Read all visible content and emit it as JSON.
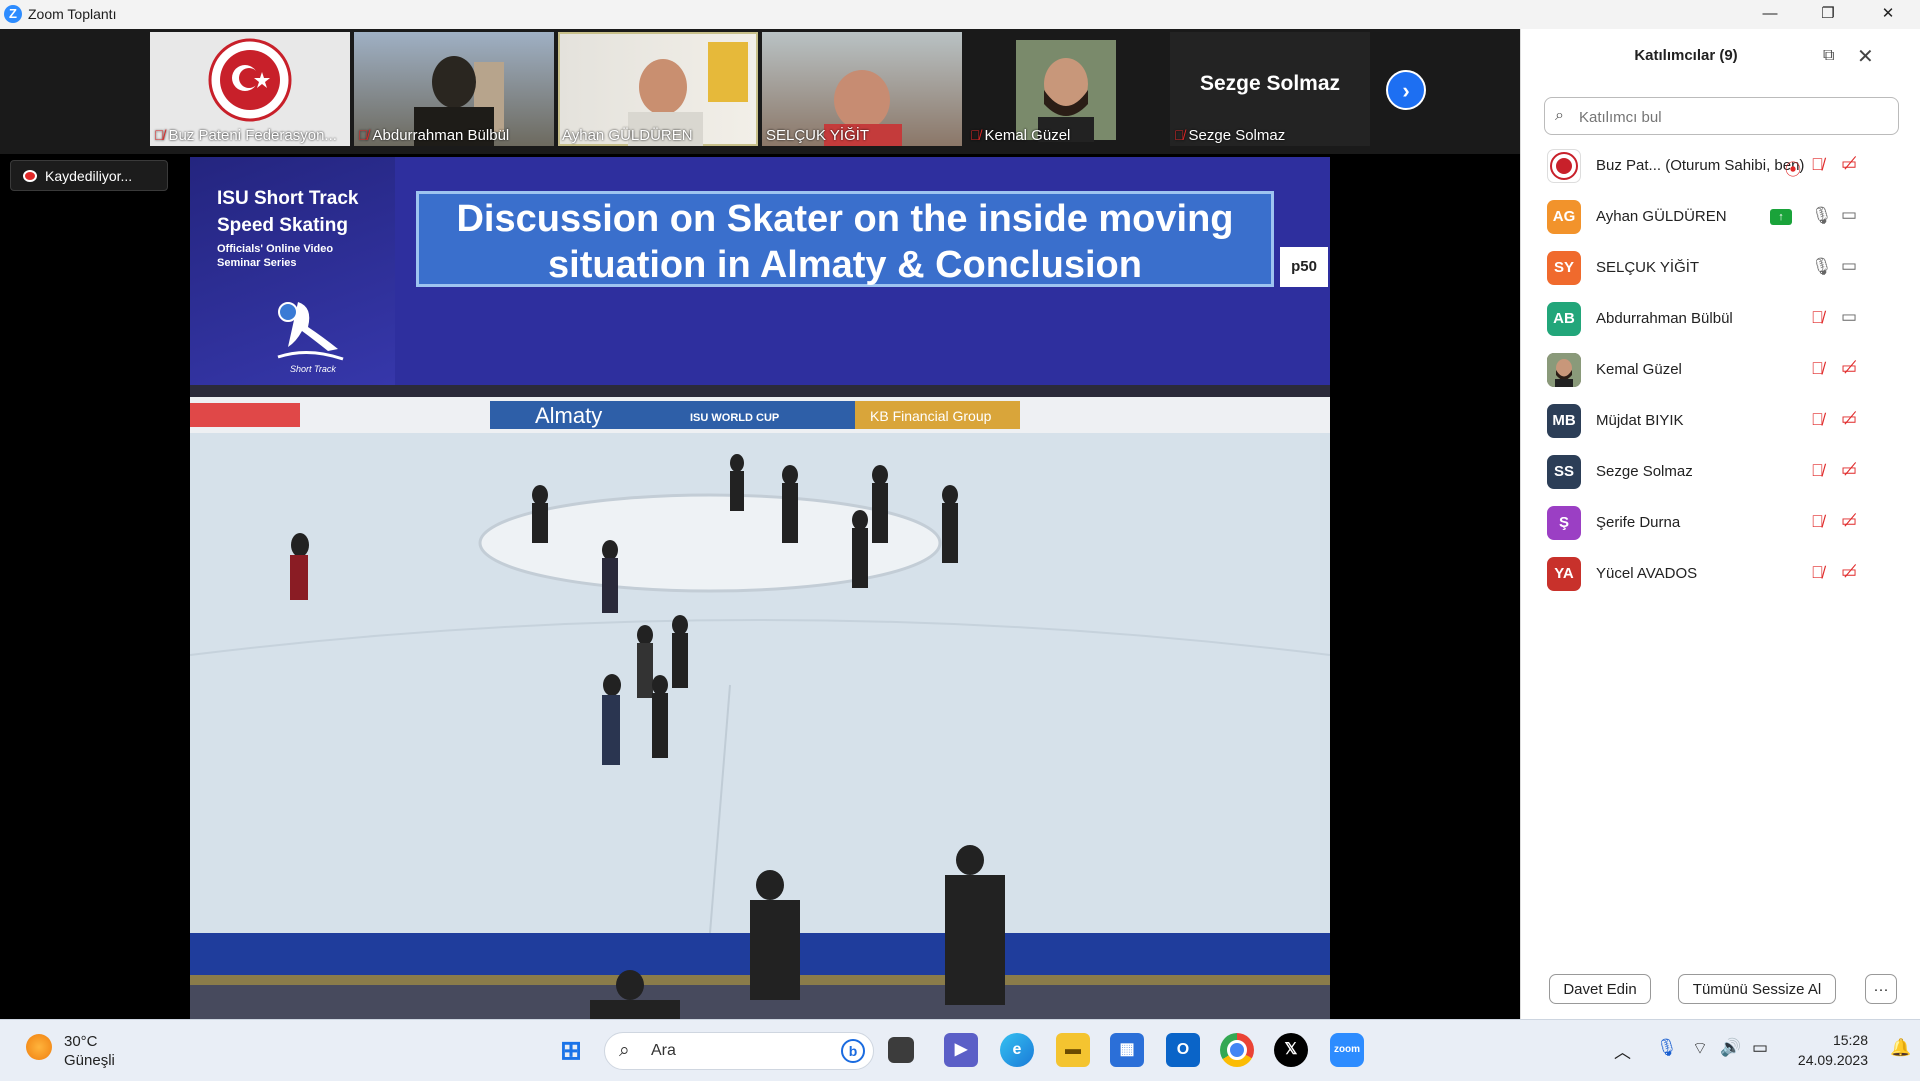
{
  "window": {
    "title": "Zoom Toplantı",
    "minimize": "—",
    "restore": "❐",
    "close": "✕"
  },
  "strip": {
    "tiles": [
      {
        "name": "Buz Pateni Federasyon...",
        "muted": true
      },
      {
        "name": "Abdurrahman Bülbül",
        "muted": true
      },
      {
        "name": "Ayhan GÜLDÜREN",
        "muted": false
      },
      {
        "name": "SELÇUK YİĞİT",
        "muted": false
      },
      {
        "name": "Kemal Güzel",
        "muted": true
      },
      {
        "name": "Sezge Solmaz",
        "muted": true,
        "big_label": "Sezge Solmaz"
      }
    ],
    "next": "›"
  },
  "recording": {
    "label": "Kaydediliyor..."
  },
  "slide": {
    "brand_line1": "ISU Short Track",
    "brand_line2": "Speed Skating",
    "brand_sub1": "Officials' Online Video",
    "brand_sub2": "Seminar Series",
    "logo_text": "Short Track",
    "title_line1": "Discussion on Skater on the inside moving",
    "title_line2": "situation in Almaty & Conclusion",
    "page": "p50",
    "banner": [
      "Almaty",
      "ISU WORLD CUP",
      "KB Financial Group"
    ]
  },
  "panel": {
    "title": "Katılımcılar (9)",
    "search_placeholder": "Katılımcı bul",
    "participants": [
      {
        "initials": "",
        "name": "Buz Pat...   (Oturum Sahibi, ben)",
        "color": "#ffffff",
        "mic_muted": true,
        "cam_off": true,
        "host": true
      },
      {
        "initials": "AG",
        "name": "Ayhan GÜLDÜREN",
        "color": "#f2932b",
        "mic_muted": false,
        "cam_off": false,
        "sharing": true
      },
      {
        "initials": "SY",
        "name": "SELÇUK YİĞİT",
        "color": "#f06a2d",
        "mic_muted": false,
        "cam_off": false
      },
      {
        "initials": "AB",
        "name": "Abdurrahman Bülbül",
        "color": "#22a67a",
        "mic_muted": true,
        "cam_off": false
      },
      {
        "initials": "",
        "name": "Kemal Güzel",
        "color": "#6b5a4a",
        "mic_muted": true,
        "cam_off": true,
        "photo": true
      },
      {
        "initials": "MB",
        "name": "Müjdat BIYIK",
        "color": "#2c3e57",
        "mic_muted": true,
        "cam_off": true
      },
      {
        "initials": "SS",
        "name": "Sezge Solmaz",
        "color": "#2c3e57",
        "mic_muted": true,
        "cam_off": true
      },
      {
        "initials": "Ş",
        "name": "Şerife Durna",
        "color": "#9b3fc4",
        "mic_muted": true,
        "cam_off": true
      },
      {
        "initials": "YA",
        "name": "Yücel AVADOS",
        "color": "#c8312b",
        "mic_muted": true,
        "cam_off": true
      }
    ],
    "invite": "Davet Edin",
    "mute_all": "Tümünü Sessize Al",
    "more": "···"
  },
  "taskbar": {
    "temp": "30°C",
    "weather": "Güneşli",
    "search": "Ara",
    "time": "15:28",
    "date": "24.09.2023",
    "apps": [
      "windows-icon",
      "file-manager-icon",
      "meet-icon",
      "edge-icon",
      "explorer-icon",
      "store-icon",
      "outlook-icon",
      "chrome-icon",
      "x-icon",
      "zoom-icon"
    ]
  }
}
